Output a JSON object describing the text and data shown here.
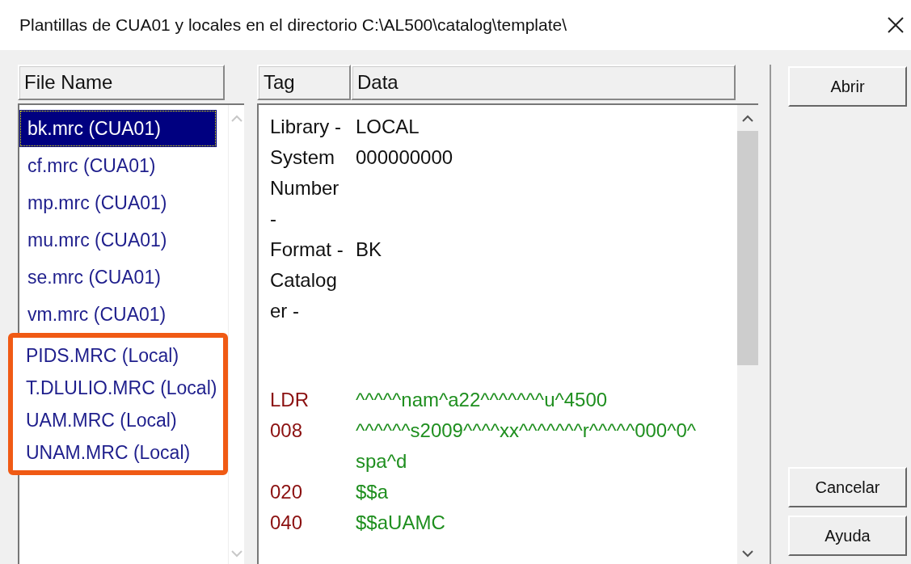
{
  "window": {
    "title": "Plantillas de CUA01 y locales en el directorio C:\\AL500\\catalog\\template\\"
  },
  "file_list": {
    "header": "File Name",
    "items": [
      {
        "label": "bk.mrc (CUA01)",
        "selected": true,
        "highlighted": false
      },
      {
        "label": "cf.mrc (CUA01)",
        "selected": false,
        "highlighted": false
      },
      {
        "label": "mp.mrc (CUA01)",
        "selected": false,
        "highlighted": false
      },
      {
        "label": "mu.mrc (CUA01)",
        "selected": false,
        "highlighted": false
      },
      {
        "label": "se.mrc (CUA01)",
        "selected": false,
        "highlighted": false
      },
      {
        "label": "vm.mrc (CUA01)",
        "selected": false,
        "highlighted": false
      },
      {
        "label": "PIDS.MRC (Local)",
        "selected": false,
        "highlighted": true
      },
      {
        "label": "T.DLULIO.MRC (Local)",
        "selected": false,
        "highlighted": true
      },
      {
        "label": "UAM.MRC (Local)",
        "selected": false,
        "highlighted": true
      },
      {
        "label": "UNAM.MRC (Local)",
        "selected": false,
        "highlighted": true
      }
    ]
  },
  "record": {
    "columns": [
      "Tag",
      "Data"
    ],
    "rows": [
      {
        "kind": "info",
        "tag": "Library -",
        "data": "LOCAL"
      },
      {
        "kind": "info",
        "tag": "System Number -",
        "data": "000000000"
      },
      {
        "kind": "info",
        "tag": "Format -",
        "data": "BK"
      },
      {
        "kind": "info",
        "tag": "Cataloger -"
      },
      {
        "kind": "gap"
      },
      {
        "kind": "field",
        "tag": "LDR",
        "data": "^^^^^nam^a22^^^^^^^u^4500"
      },
      {
        "kind": "field",
        "tag": "008",
        "data": "^^^^^^s2009^^^^xx^^^^^^^r^^^^^000^0^spa^d"
      },
      {
        "kind": "field",
        "tag": "020",
        "data": "$$a"
      },
      {
        "kind": "field",
        "tag": "040",
        "data": "$$aUAMC"
      }
    ]
  },
  "buttons": [
    "Abrir",
    "Cancelar",
    "Ayuda"
  ]
}
